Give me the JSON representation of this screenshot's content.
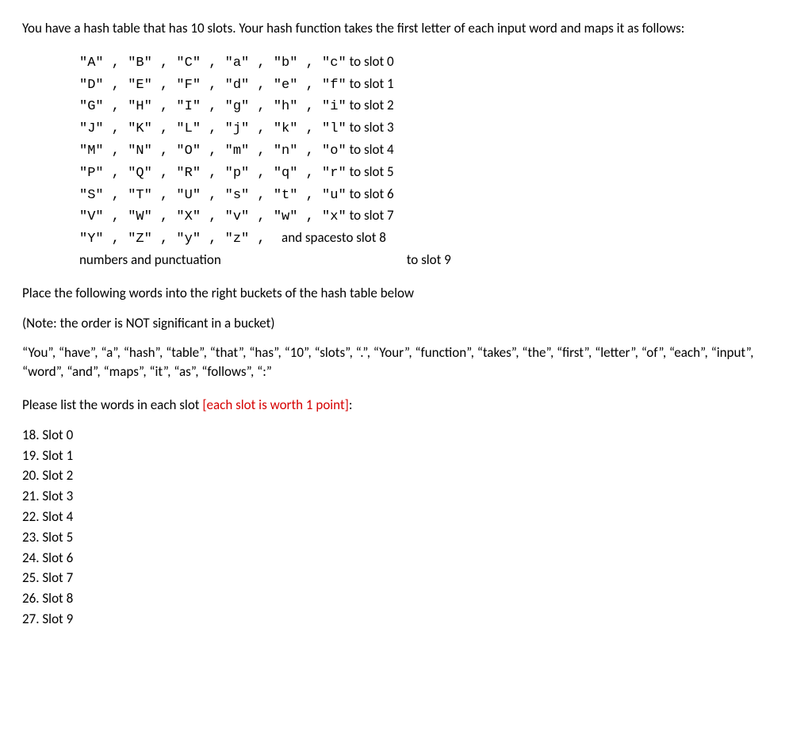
{
  "intro": "You have a hash table that has 10 slots.  Your hash function takes the first letter of each input word and maps it as follows:",
  "mapping": [
    {
      "letters": "\"A\" , \"B\" , \"C\" , \"a\" , \"b\" , \"c\"",
      "target": "to slot 0"
    },
    {
      "letters": "\"D\" , \"E\" , \"F\" , \"d\" , \"e\" , \"f\"",
      "target": "to slot 1"
    },
    {
      "letters": "\"G\" , \"H\" , \"I\" , \"g\" , \"h\" , \"i\"",
      "target": "to slot 2"
    },
    {
      "letters": "\"J\" , \"K\" , \"L\" , \"j\" , \"k\" , \"l\"",
      "target": "to slot 3"
    },
    {
      "letters": "\"M\" , \"N\" , \"O\" , \"m\" , \"n\" , \"o\"",
      "target": "to slot 4"
    },
    {
      "letters": "\"P\" , \"Q\" , \"R\" , \"p\" , \"q\" , \"r\"",
      "target": "to slot 5"
    },
    {
      "letters": "\"S\" , \"T\" , \"U\" , \"s\" , \"t\" , \"u\"",
      "target": "to slot 6"
    },
    {
      "letters": "\"V\" , \"W\" , \"X\" , \"v\" , \"w\" , \"x\"",
      "target": "to slot 7"
    }
  ],
  "mapping_yz": {
    "letters": "\"Y\" , \"Z\" , \"y\" , \"z\" ,  ",
    "extra": "and spaces",
    "target": "  to slot 8"
  },
  "mapping_numbers": {
    "letters": "numbers and punctuation",
    "target": "to slot 9"
  },
  "place_text": "Place the following words into the right buckets of the hash table below",
  "note_text": "(Note: the order is NOT significant in a bucket)",
  "words_text": "“You”, “have”, “a”, “hash”, “table”, “that”, “has”, “10”, “slots”, “.”, “Your”, “function”, “takes”, “the”, “first”, “letter”, “of”, “each”, “input”, “word”, “and”, “maps”, “it”, “as”, “follows”, “:”",
  "please_prefix": "Please list the words in each slot ",
  "please_highlight": "[each slot is worth 1 point]",
  "please_suffix": ":",
  "slots": [
    {
      "num": "18.",
      "label": "Slot 0"
    },
    {
      "num": "19.",
      "label": "Slot 1"
    },
    {
      "num": "20.",
      "label": "Slot 2"
    },
    {
      "num": "21.",
      "label": "Slot 3"
    },
    {
      "num": "22.",
      "label": "Slot 4"
    },
    {
      "num": "23.",
      "label": "Slot 5"
    },
    {
      "num": "24.",
      "label": "Slot 6"
    },
    {
      "num": "25.",
      "label": "Slot 7"
    },
    {
      "num": "26.",
      "label": "Slot 8"
    },
    {
      "num": "27.",
      "label": "Slot 9"
    }
  ]
}
